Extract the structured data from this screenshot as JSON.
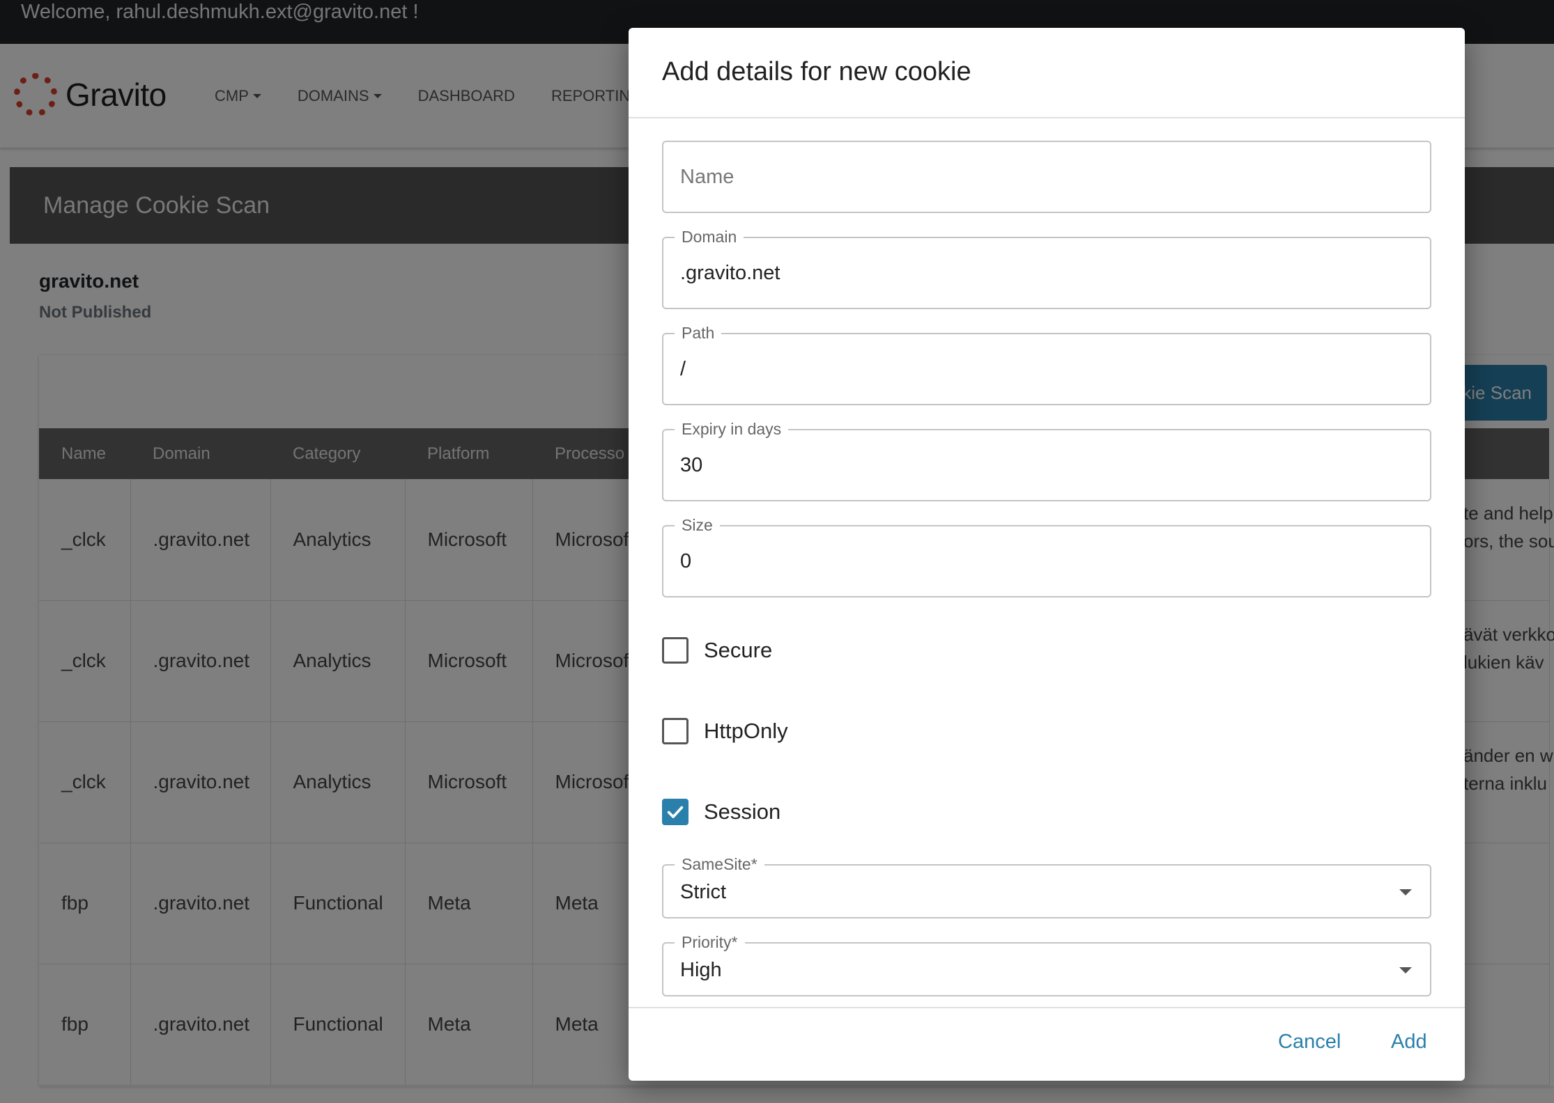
{
  "welcome": "Welcome, rahul.deshmukh.ext@gravito.net !",
  "brand": {
    "name": "Gravito",
    "color": "#d9402b"
  },
  "nav": {
    "items": [
      {
        "label": "CMP",
        "dropdown": true
      },
      {
        "label": "DOMAINS",
        "dropdown": true
      },
      {
        "label": "DASHBOARD",
        "dropdown": false
      },
      {
        "label": "REPORTIN",
        "dropdown": false
      }
    ]
  },
  "page": {
    "header": "Manage Cookie Scan",
    "domain": "gravito.net",
    "status": "Not Published",
    "scan_button": "kie Scan"
  },
  "table": {
    "headers": [
      "Name",
      "Domain",
      "Category",
      "Platform",
      "Processo"
    ],
    "rows": [
      [
        "_clck",
        ".gravito.net",
        "Analytics",
        "Microsoft",
        "Microsof"
      ],
      [
        "_clck",
        ".gravito.net",
        "Analytics",
        "Microsoft",
        "Microsof"
      ],
      [
        "_clck",
        ".gravito.net",
        "Analytics",
        "Microsoft",
        "Microsof"
      ],
      [
        "fbp",
        ".gravito.net",
        "Functional",
        "Meta",
        "Meta"
      ],
      [
        "fbp",
        ".gravito.net",
        "Functional",
        "Meta",
        "Meta"
      ]
    ],
    "description_fragments": [
      [
        "te and help",
        "ors, the sou"
      ],
      [
        "ävät verkko",
        "lukien käv"
      ],
      [
        "änder en w",
        "terna inklu"
      ]
    ]
  },
  "modal": {
    "title": "Add details for new cookie",
    "name": {
      "placeholder": "Name",
      "value": ""
    },
    "domain": {
      "label": "Domain",
      "value": ".gravito.net"
    },
    "path": {
      "label": "Path",
      "value": "/"
    },
    "expiry": {
      "label": "Expiry in days",
      "value": "30"
    },
    "size": {
      "label": "Size",
      "value": "0"
    },
    "secure": {
      "label": "Secure",
      "checked": false
    },
    "httponly": {
      "label": "HttpOnly",
      "checked": false
    },
    "session": {
      "label": "Session",
      "checked": true
    },
    "samesite": {
      "label": "SameSite*",
      "value": "Strict"
    },
    "priority": {
      "label": "Priority*",
      "value": "High"
    },
    "cancel": "Cancel",
    "add": "Add"
  },
  "colors": {
    "accent": "#2a7fab",
    "header_bg": "#545454",
    "topbar_bg": "#212529"
  }
}
